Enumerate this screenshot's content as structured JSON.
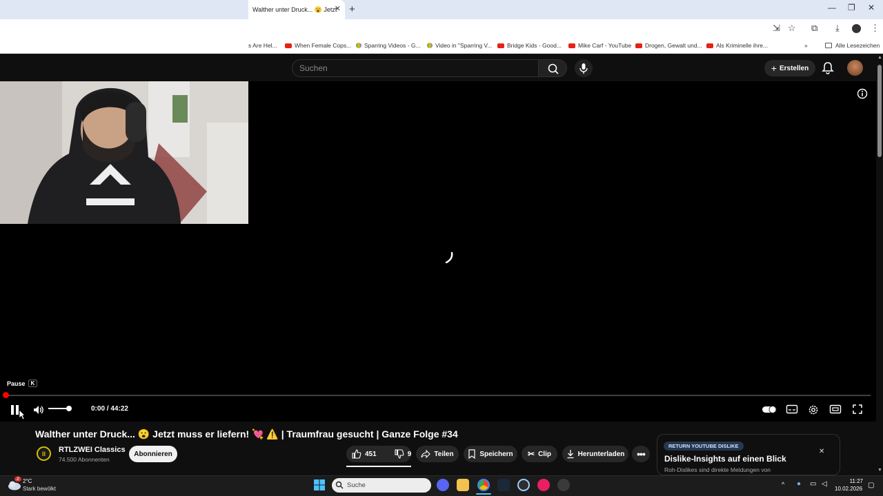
{
  "browser": {
    "tab_title": "Walther unter Druck... 😮 Jetzt",
    "bookmarks": [
      "s Are Hel...",
      "When Female Cops...",
      "Sparring Videos - G...",
      "Video in \"Sparring V...",
      "Bridge Kids - Good...",
      "Mike Carf - YouTube",
      "Drogen, Gewalt und...",
      "Als Kriminelle ihre..."
    ],
    "all_bookmarks": "Alle Lesezeichen"
  },
  "youtube": {
    "search_placeholder": "Suchen",
    "create_label": "Erstellen"
  },
  "player": {
    "tooltip_label": "Pause",
    "tooltip_key": "K",
    "time_current": "0:00",
    "time_separator": "/",
    "time_total": "44:22",
    "progress_fraction": 0.0,
    "volume_fraction": 0.9
  },
  "video": {
    "title": "Walther unter Druck... 😮 Jetzt muss er liefern! 💘 ⚠️ | Traumfrau gesucht | Ganze Folge #34",
    "channel_name": "RTLZWEI Classics",
    "channel_logo_text": "II",
    "subscribers": "74.500 Abonnenten",
    "subscribe_label": "Abonnieren",
    "likes": "451",
    "dislikes": "9",
    "share_label": "Teilen",
    "save_label": "Speichern",
    "clip_label": "Clip",
    "download_label": "Herunterladen"
  },
  "ryd_panel": {
    "badge": "RETURN YOUTUBE DISLIKE",
    "title": "Dislike-Insights auf einen Blick",
    "subtitle": "Roh-Dislikes sind direkte Meldungen von"
  },
  "taskbar": {
    "weather_temp": "2°C",
    "weather_desc": "Stark bewölkt",
    "weather_badge": "2",
    "search_placeholder": "Suche",
    "time": "11:27",
    "date": "10.02.2026"
  },
  "colors": {
    "accent_red": "#ff0000",
    "bg": "#0f0f0f",
    "pill_bg": "#272727"
  }
}
